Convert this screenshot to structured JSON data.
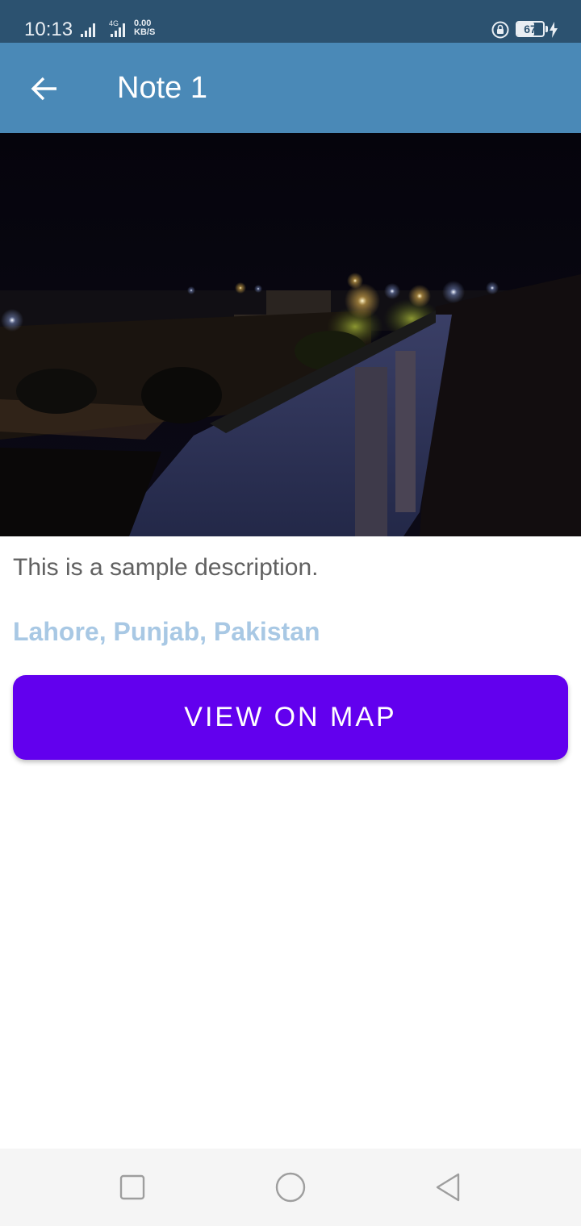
{
  "status_bar": {
    "time": "10:13",
    "network_type": "4G",
    "speed_value": "0.00",
    "speed_unit": "KB/S",
    "battery_level": "67",
    "icons": [
      "signal-icon",
      "signal-icon",
      "lock-rotation-icon",
      "battery-icon",
      "charging-icon"
    ]
  },
  "app_bar": {
    "title": "Note 1",
    "back_icon": "arrow-left-icon",
    "color": "#4a89b7"
  },
  "note": {
    "image": "night-photo",
    "description": "This is a sample description.",
    "location": "Lahore, Punjab, Pakistan",
    "location_color": "#a8c8e4"
  },
  "actions": {
    "map_button_label": "VIEW ON MAP",
    "map_button_color": "#6200ee"
  },
  "nav_bar": {
    "icons": [
      "square-recent-icon",
      "circle-home-icon",
      "triangle-back-icon"
    ]
  }
}
